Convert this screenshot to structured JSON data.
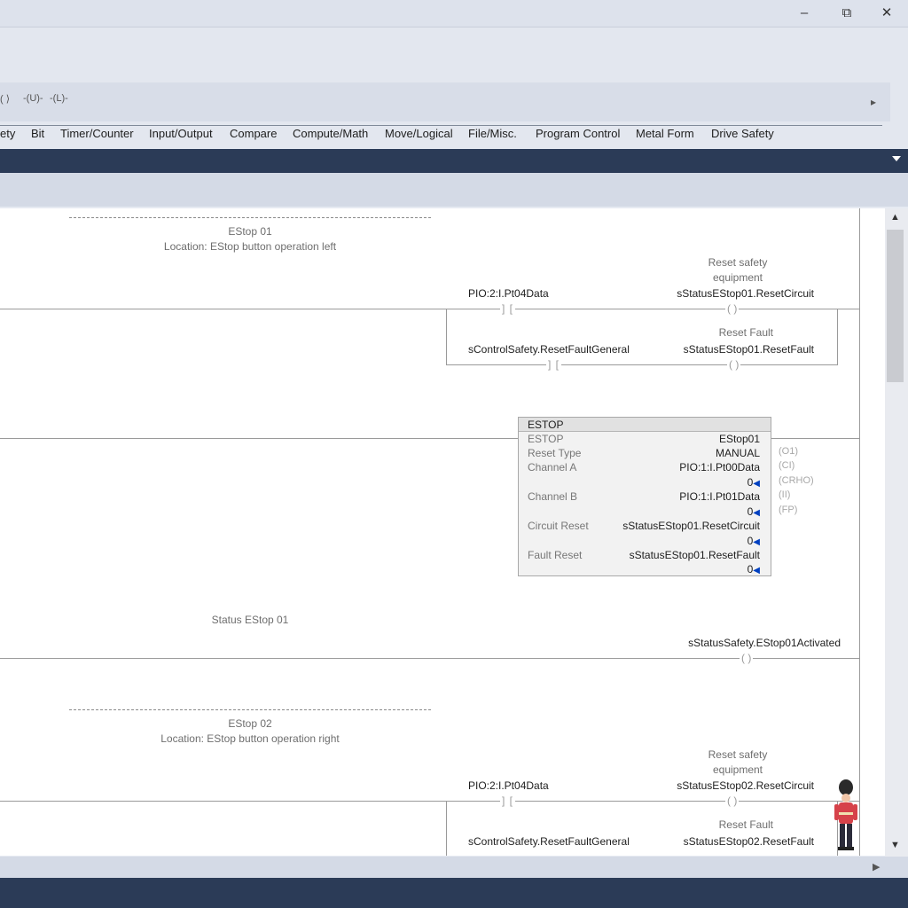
{
  "window": {
    "minimize": "–",
    "restore": "⧉",
    "close": "✕"
  },
  "toolbar": {
    "partial_left": "( ⟩",
    "instr_unlatch": "-(U)-",
    "instr_latch": "-(L)-",
    "scroll_right": "▸",
    "tabs": [
      "ety",
      "Bit",
      "Timer/Counter",
      "Input/Output",
      "Compare",
      "Compute/Math",
      "Move/Logical",
      "File/Misc.",
      "Program Control",
      "Metal Form",
      "Drive Safety"
    ]
  },
  "ladder": {
    "rung1": {
      "title": "EStop 01",
      "location": "Location: EStop button operation left",
      "coil1_desc1": "Reset safety",
      "coil1_desc2": "equipment",
      "contact1_tag": "PIO:2:I.Pt04Data",
      "coil1_tag": "sStatusEStop01.ResetCircuit",
      "coil2_desc": "Reset Fault",
      "contact2_tag": "sControlSafety.ResetFaultGeneral",
      "coil2_tag": "sStatusEStop01.ResetFault"
    },
    "estop_block": {
      "header": "ESTOP",
      "rows": [
        {
          "label": "ESTOP",
          "value": "EStop01"
        },
        {
          "label": "Reset Type",
          "value": "MANUAL"
        },
        {
          "label": "Channel A",
          "value": "PIO:1:I.Pt00Data"
        },
        {
          "label": "Channel B",
          "value": "PIO:1:I.Pt01Data"
        },
        {
          "label": "Circuit Reset",
          "value": "sStatusEStop01.ResetCircuit"
        },
        {
          "label": "Fault Reset",
          "value": "sStatusEStop01.ResetFault"
        }
      ],
      "zero": "0",
      "pins": [
        "(O1)",
        "(CI)",
        "(CRHO)",
        "(II)",
        "(FP)"
      ]
    },
    "rung3": {
      "comment": "Status EStop 01",
      "coil_tag": "sStatusSafety.EStop01Activated"
    },
    "rung4": {
      "title": "EStop 02",
      "location": "Location: EStop button operation right",
      "coil1_desc1": "Reset safety",
      "coil1_desc2": "equipment",
      "contact1_tag": "PIO:2:I.Pt04Data",
      "coil1_tag": "sStatusEStop02.ResetCircuit",
      "coil2_desc": "Reset Fault",
      "contact2_tag": "sControlSafety.ResetFaultGeneral",
      "coil2_tag": "sStatusEStop02.ResetFault"
    },
    "symbols": {
      "coil": "(  )",
      "contact": "] ["
    }
  },
  "scrollbar": {
    "up": "▲",
    "down": "▼",
    "right": "▶"
  }
}
